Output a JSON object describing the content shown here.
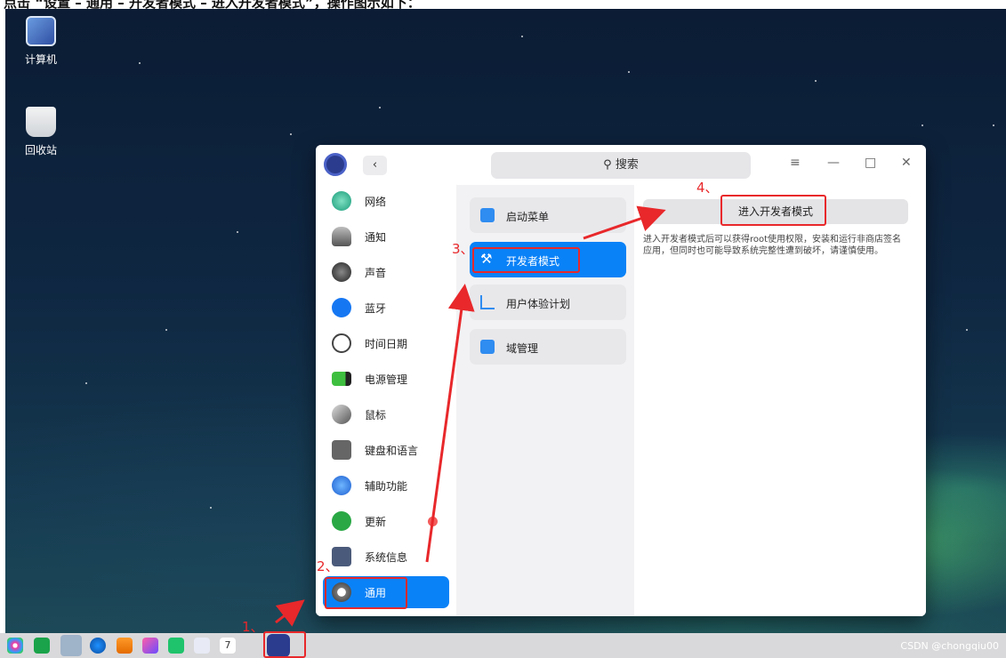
{
  "instruction_text": "点击 “设置 – 通用 – 开发者模式 – 进入开发者模式”，操作图示如下：",
  "desktop_icons": [
    {
      "label": "计算机",
      "icon": "computer-icon"
    },
    {
      "label": "回收站",
      "icon": "trash-icon"
    }
  ],
  "window": {
    "search_label": "搜索",
    "back_glyph": "‹",
    "menu_glyph": "≡",
    "min_glyph": "—",
    "max_glyph": "□",
    "close_glyph": "✕"
  },
  "sidebar": {
    "items": [
      {
        "label": "网络",
        "icon": "network-icon"
      },
      {
        "label": "通知",
        "icon": "notification-bell-icon"
      },
      {
        "label": "声音",
        "icon": "speaker-icon"
      },
      {
        "label": "蓝牙",
        "icon": "bluetooth-icon"
      },
      {
        "label": "时间日期",
        "icon": "clock-icon"
      },
      {
        "label": "电源管理",
        "icon": "battery-icon"
      },
      {
        "label": "鼠标",
        "icon": "mouse-icon"
      },
      {
        "label": "键盘和语言",
        "icon": "keyboard-icon"
      },
      {
        "label": "辅助功能",
        "icon": "accessibility-icon"
      },
      {
        "label": "更新",
        "icon": "update-arrow-icon"
      },
      {
        "label": "系统信息",
        "icon": "system-info-icon"
      },
      {
        "label": "通用",
        "icon": "gear-icon"
      }
    ],
    "active_index": 11
  },
  "middle": {
    "items": [
      {
        "label": "启动菜单",
        "icon": "boot-menu-icon"
      },
      {
        "label": "开发者模式",
        "icon": "tools-icon"
      },
      {
        "label": "用户体验计划",
        "icon": "chart-trend-icon"
      },
      {
        "label": "域管理",
        "icon": "domain-icon"
      }
    ],
    "active_index": 1
  },
  "detail": {
    "button_label": "进入开发者模式",
    "description": "进入开发者模式后可以获得root使用权限，安装和运行非商店签名应用，但同时也可能导致系统完整性遭到破坏，请谨慎使用。"
  },
  "annotations": {
    "step1": "1、",
    "step2": "2、",
    "step3": "3、",
    "step4": "4、",
    "color": "#e8282b"
  },
  "dock": {
    "items": [
      "launcher-icon",
      "multitask-icon",
      "file-manager-icon",
      "browser-icon",
      "app-store-icon",
      "photos-icon",
      "music-icon",
      "document-viewer-icon",
      "calendar-icon",
      "settings-gear-icon"
    ],
    "calendar_day": "7"
  },
  "watermark": "CSDN @chongqiu00",
  "colors": {
    "accent": "#0a82f7",
    "annotation": "#e8282b"
  }
}
